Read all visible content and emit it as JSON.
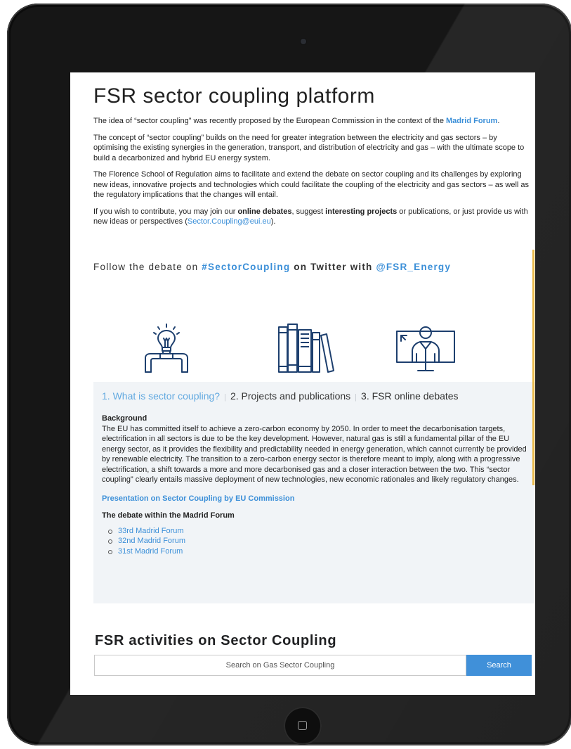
{
  "page": {
    "title": "FSR sector coupling platform",
    "intro_p1_before": "The idea of “sector coupling” was recently proposed by the European Commission in the context of the ",
    "intro_p1_link": "Madrid Forum",
    "intro_p1_after": ".",
    "intro_p2": "The concept of “sector coupling” builds on the need for greater integration between the electricity and gas sectors – by optimising the existing synergies in the generation, transport, and distribution of electricity and gas – with the ultimate scope to build a decarbonized and hybrid EU energy system.",
    "intro_p3": "The Florence School of Regulation aims to facilitate and extend the debate on sector coupling and its challenges by exploring new ideas, innovative projects and technologies which could facilitate the coupling of the electricity and gas sectors – as well as the regulatory implications that the changes will entail.",
    "intro_p4_a": "If you wish to contribute, you may join our ",
    "intro_p4_b": "online debates",
    "intro_p4_c": ", suggest ",
    "intro_p4_d": "interesting projects",
    "intro_p4_e": " or publications, or just provide us with new ideas or perspectives (",
    "intro_p4_email": "Sector.Coupling@eui.eu",
    "intro_p4_f": ")."
  },
  "twitter": {
    "prefix": "Follow the debate on ",
    "hashtag": "#SectorCoupling",
    "middle": " on Twitter with ",
    "handle": "@FSR_Energy"
  },
  "icons": [
    "lightbulb-icon",
    "books-icon",
    "online-debate-icon"
  ],
  "tabs": [
    {
      "label": "1. What is sector coupling?",
      "active": true
    },
    {
      "label": "2. Projects and publications",
      "active": false
    },
    {
      "label": "3. FSR online debates",
      "active": false
    }
  ],
  "tab_separator": "|",
  "panel": {
    "heading": "Background",
    "text": "The EU has committed itself to achieve a zero-carbon economy by 2050. In order to meet the decarbonisation targets, electrification in all sectors is due to be the key development. However, natural gas is still a fundamental pillar of the EU energy sector, as it provides the flexibility and predictability needed in energy generation, which cannot currently be provided by renewable electricity. The transition to a zero-carbon energy sector is therefore meant to imply, along with a progressive electrification, a shift towards a more and more decarbonised gas and a closer interaction between the two. This “sector coupling” clearly entails massive deployment of new technologies, new economic rationales and likely regulatory changes.",
    "presentation_link": "Presentation on Sector Coupling by EU Commission",
    "debate_heading": "The debate within the Madrid Forum",
    "forums": [
      "33rd Madrid Forum",
      "32nd Madrid Forum",
      "31st Madrid Forum"
    ]
  },
  "activities": {
    "title": "FSR activities on Sector Coupling",
    "search_placeholder": "Search on Gas Sector Coupling",
    "search_button": "Search"
  },
  "colors": {
    "accent": "#3b8fd8",
    "active_tab": "#62a9e0",
    "icon_stroke": "#1d3f6e",
    "search_button": "#4090d9",
    "panel_bg": "#f1f4f7",
    "device_frame": "#161616"
  }
}
